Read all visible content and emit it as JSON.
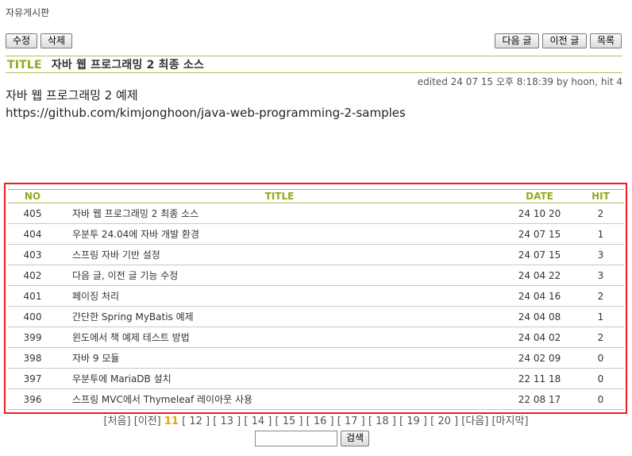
{
  "board": {
    "name": "자유게시판"
  },
  "toolbar": {
    "edit_label": "수정",
    "delete_label": "삭제",
    "next_label": "다음 글",
    "prev_label": "이전 글",
    "list_label": "목록"
  },
  "article": {
    "tag": "TITLE",
    "title": "자바 웹 프로그래밍 2 최종 소스",
    "meta": "edited 24 07 15 오후 8:18:39 by hoon, hit 4",
    "body_line1": "자바 웹 프로그래밍 2 예제",
    "body_line2": "https://github.com/kimjonghoon/java-web-programming-2-samples"
  },
  "list": {
    "headers": {
      "no": "NO",
      "title": "TITLE",
      "date": "DATE",
      "hit": "HIT"
    },
    "rows": [
      {
        "no": "405",
        "title": "자바 웹 프로그래밍 2 최종 소스",
        "date": "24 10 20",
        "hit": "2"
      },
      {
        "no": "404",
        "title": "우분투 24.04에 자바 개발 환경",
        "date": "24 07 15",
        "hit": "1"
      },
      {
        "no": "403",
        "title": "스프링 자바 기반 설정",
        "date": "24 07 15",
        "hit": "3"
      },
      {
        "no": "402",
        "title": "다음 글, 이전 글 기능 수정",
        "date": "24 04 22",
        "hit": "3"
      },
      {
        "no": "401",
        "title": "페이징 처리",
        "date": "24 04 16",
        "hit": "2"
      },
      {
        "no": "400",
        "title": "간단한 Spring MyBatis 예제",
        "date": "24 04 08",
        "hit": "1"
      },
      {
        "no": "399",
        "title": "윈도에서 책 예제 테스트 방법",
        "date": "24 04 02",
        "hit": "2"
      },
      {
        "no": "398",
        "title": "자바 9 모듈",
        "date": "24 02 09",
        "hit": "0"
      },
      {
        "no": "397",
        "title": "우분투에 MariaDB 설치",
        "date": "22 11 18",
        "hit": "0"
      },
      {
        "no": "396",
        "title": "스프링 MVC에서 Thymeleaf 레이아웃 사용",
        "date": "22 08 17",
        "hit": "0"
      }
    ]
  },
  "pagination": {
    "first": "[처음]",
    "prev": "[이전]",
    "pages": [
      "11",
      "12",
      "13",
      "14",
      "15",
      "16",
      "17",
      "18",
      "19",
      "20"
    ],
    "current": "11",
    "next": "[다음]",
    "last": "[마지막]"
  },
  "search": {
    "value": "",
    "button_label": "검색"
  },
  "colors": {
    "accent": "#8fac1a",
    "rule": "#b3bf62",
    "current_page": "#f0a000",
    "highlight_border": "#ee1b1b"
  }
}
